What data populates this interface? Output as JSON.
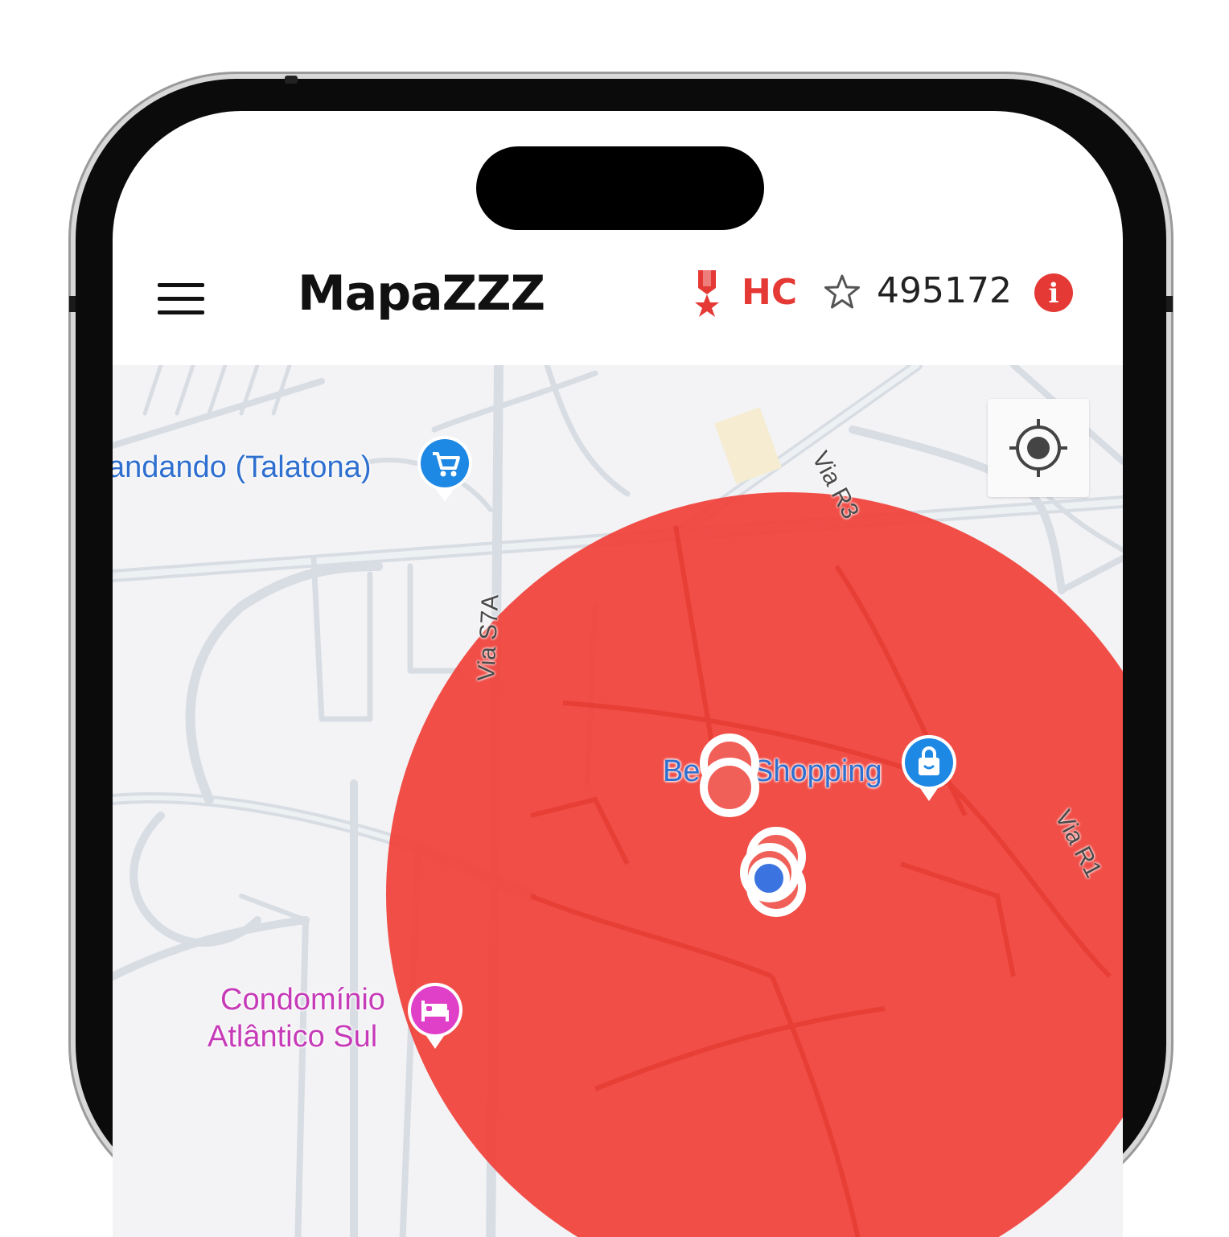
{
  "app": {
    "title": "MapaZZZ",
    "rank": "HC",
    "points": "495172",
    "accent_color": "#e53935"
  },
  "header": {
    "menu_icon": "hamburger-menu-icon",
    "medal_icon": "medal-icon",
    "star_icon": "star-outline-icon",
    "info_icon": "info-icon",
    "info_glyph": "i"
  },
  "map": {
    "locate_icon": "my-location-icon",
    "zone_color": "#f0413a",
    "pois": [
      {
        "label": "andando (Talatona)",
        "icon": "shopping-cart-icon",
        "color": "#1e88e5"
      },
      {
        "label_left": "Be",
        "label_right": "Shopping",
        "icon": "shopping-bag-icon",
        "color": "#1e88e5"
      },
      {
        "label_line1": "Condomínio",
        "label_line2": "Atlântico Sul",
        "icon": "hotel-bed-icon",
        "color": "#e040c8"
      }
    ],
    "streets": [
      "Via R3",
      "Via S7A",
      "Via R1"
    ]
  }
}
